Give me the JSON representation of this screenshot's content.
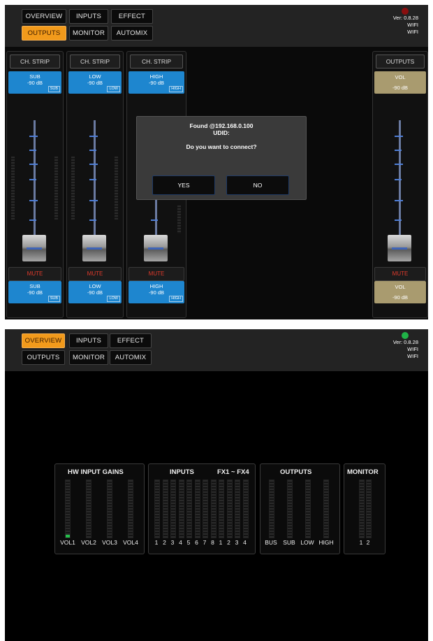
{
  "tabs": {
    "overview": "OVERVIEW",
    "inputs": "INPUTS",
    "effect": "EFFECT",
    "outputs": "OUTPUTS",
    "monitor": "MONITOR",
    "automix": "AUTOMIX"
  },
  "status": {
    "version": "Ver: 0.8.28",
    "wifi_line1": "WIFI",
    "wifi_line2": "WIFI",
    "disconnected_color": "#8a0f0f",
    "connected_color": "#20b347"
  },
  "colors": {
    "accent": "#f29a1b",
    "channel_blue": "#1e86cf",
    "output_gold": "#a99b6f",
    "mute_red": "#e03a2b"
  },
  "strips": [
    {
      "head": "CH. STRIP",
      "name": "SUB",
      "value": "-90 dB",
      "tag": "SUB",
      "mute": "MUTE"
    },
    {
      "head": "CH. STRIP",
      "name": "LOW",
      "value": "-90 dB",
      "tag": "LOW",
      "mute": "MUTE"
    },
    {
      "head": "CH. STRIP",
      "name": "HIGH",
      "value": "-90 dB",
      "tag": "HIGH",
      "mute": "MUTE"
    }
  ],
  "outputs_strip": {
    "head": "OUTPUTS",
    "name": "VOL",
    "value": "-90 dB",
    "mute": "MUTE"
  },
  "dialog": {
    "found": "Found @192.168.0.100",
    "udid": "UDID:",
    "question": "Do you want to connect?",
    "yes": "YES",
    "no": "NO"
  },
  "overview": {
    "hw_title": "HW INPUT GAINS",
    "hw_labels": [
      "VOL1",
      "VOL2",
      "VOL3",
      "VOL4"
    ],
    "hw_levels": [
      0.05,
      0,
      0,
      0
    ],
    "inputs_title": "INPUTS",
    "fx_title": "FX1 ~ FX4",
    "input_labels": [
      "1",
      "2",
      "3",
      "4",
      "5",
      "6",
      "7",
      "8"
    ],
    "fx_labels": [
      "1",
      "2",
      "3",
      "4"
    ],
    "outputs_title": "OUTPUTS",
    "output_labels": [
      "BUS",
      "SUB",
      "LOW",
      "HIGH"
    ],
    "monitor_title": "MONITOR",
    "monitor_labels": [
      "1",
      "2"
    ]
  }
}
